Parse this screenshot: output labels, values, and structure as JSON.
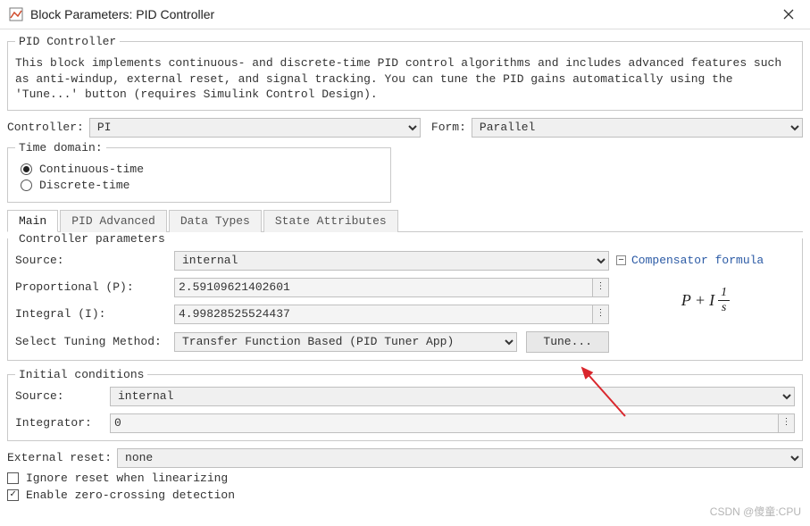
{
  "window": {
    "title": "Block Parameters: PID Controller"
  },
  "header": {
    "legend": "PID Controller",
    "description": "This block implements continuous- and discrete-time PID control algorithms and includes advanced features such as anti-windup, external reset, and signal tracking. You can tune the PID gains automatically using the 'Tune...' button (requires Simulink Control Design)."
  },
  "controller_row": {
    "controller_label": "Controller:",
    "controller_value": "PI",
    "form_label": "Form:",
    "form_value": "Parallel"
  },
  "time_domain": {
    "legend": "Time domain:",
    "continuous": "Continuous-time",
    "discrete": "Discrete-time",
    "selected": "continuous"
  },
  "tabs": [
    "Main",
    "PID Advanced",
    "Data Types",
    "State Attributes"
  ],
  "active_tab": 0,
  "cp": {
    "legend": "Controller parameters",
    "source_label": "Source:",
    "source_value": "internal",
    "p_label": "Proportional (P):",
    "p_value": "2.59109621402601",
    "i_label": "Integral (I):",
    "i_value": "4.99828525524437",
    "method_label": "Select Tuning Method:",
    "method_value": "Transfer Function Based (PID Tuner App)",
    "tune_label": "Tune...",
    "comp_link": "Compensator formula"
  },
  "ic": {
    "legend": "Initial conditions",
    "source_label": "Source:",
    "source_value": "internal",
    "integrator_label": "Integrator:",
    "integrator_value": "0"
  },
  "ext_reset": {
    "label": "External reset:",
    "value": "none"
  },
  "checkboxes": {
    "ignore": "Ignore reset when linearizing",
    "ignore_checked": false,
    "zero": "Enable zero-crossing detection",
    "zero_checked": true
  },
  "watermark": "CSDN @傻童:CPU"
}
